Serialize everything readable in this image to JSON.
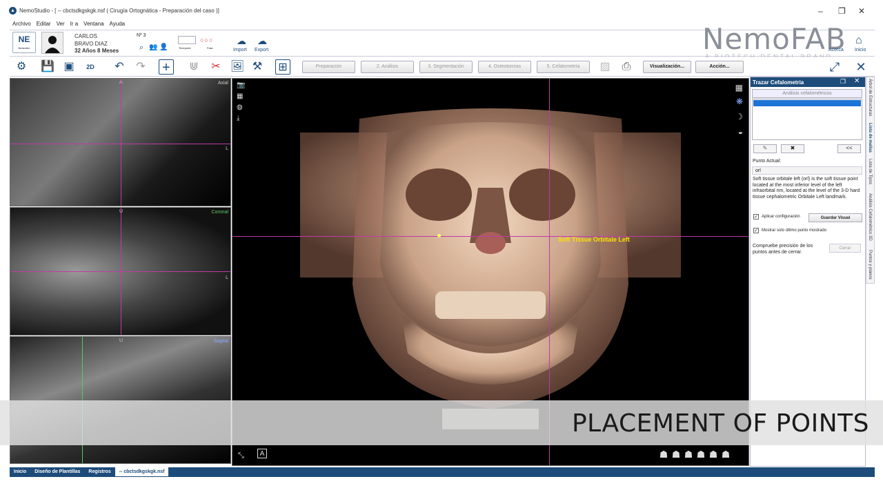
{
  "window": {
    "title": "NemoStudio - [ -- cbctsdkgskgk.nsf ( Cirugía Ortognática - Preparación del caso )]",
    "minimize": "–",
    "maximize": "❐",
    "close": "✕"
  },
  "menu": [
    "Archivo",
    "Editar",
    "Ver",
    "Ir a",
    "Ventana",
    "Ayuda"
  ],
  "patient": {
    "logo": "NE",
    "logo_sub": "Nemotec",
    "first_name": "CARLOS",
    "last_name": "BRAVO DIAZ",
    "age": "32 Años 8 Meses",
    "number": "Nº 3",
    "timepoint_label": "Timepoint",
    "phase_label": "Fase",
    "import_label": "Import",
    "export_label": "Export"
  },
  "brand": {
    "name": "NemoFAB",
    "tagline": "A BIOTECH DENTAL BRAND",
    "acerca": "Acerca",
    "inicio": "Inicio"
  },
  "workflow": {
    "steps": [
      "Preparación",
      "2. Análisis",
      "3. Segmentación",
      "4. Osteotomías",
      "5. Cefalometría"
    ],
    "visualizacion": "Visualización...",
    "accion": "Acción..."
  },
  "viewports": {
    "axial": "Axial",
    "coronal": "Coronal",
    "sagital": "Sagital",
    "marker_a": "A",
    "marker_u": "U",
    "marker_l": "L",
    "landmark_label": "Soft Tissue Orbitale Left"
  },
  "panel": {
    "title": "Trazar Cefalometria",
    "analysis_button": "Análisis cefalométricos",
    "back_button": "<<",
    "current_point_label": "Punto Actual:",
    "current_point_value": "orl",
    "description": "Soft tissue orbitale left (orl) is the soft tissue point located at the most inferior level of the left infraorbital rim, located at the level of the 3-D hard tissue cephalometric Orbitale Left landmark.",
    "apply_config": "Aplicar configuración",
    "save_visual": "Guardar Visual",
    "show_last": "Mostrar solo último punto mostrado",
    "check_precision": "Compruebe precisión de los puntos antes de cerrar.",
    "close_button": "Cerrar",
    "vertical_tabs": [
      "Árbol de Estructuras",
      "Lista de mallas",
      "Lista de Tipos",
      "Análisis Cefalométrico 3D",
      "Puntos y planos"
    ]
  },
  "statusbar": [
    "Inicio",
    "Diseño de Plantillas",
    "Registros",
    "-- cbctsdkgskgk.nsf"
  ],
  "overlay": {
    "caption": "PLACEMENT OF POINTS"
  },
  "colors": {
    "brand_blue": "#1d4c7a",
    "measure_line": "#c03aa8",
    "landmark_text": "#ffe000"
  }
}
